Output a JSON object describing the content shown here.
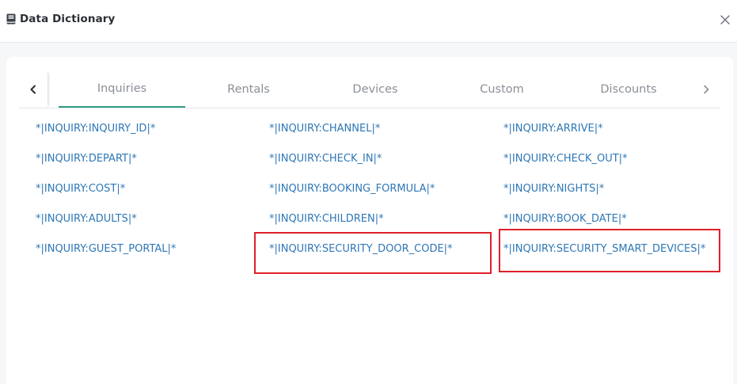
{
  "dialog": {
    "title": "Data Dictionary",
    "icons": {
      "title": "book-icon",
      "close": "close-icon"
    }
  },
  "tabs": {
    "prev_icon": "chevron-left-icon",
    "next_icon": "chevron-right-icon",
    "items": [
      {
        "label": "Inquiries",
        "active": true
      },
      {
        "label": "Rentals",
        "active": false
      },
      {
        "label": "Devices",
        "active": false
      },
      {
        "label": "Custom",
        "active": false
      },
      {
        "label": "Discounts",
        "active": false
      }
    ]
  },
  "variables": {
    "col1": [
      "*|INQUIRY:INQUIRY_ID|*",
      "*|INQUIRY:DEPART|*",
      "*|INQUIRY:COST|*",
      "*|INQUIRY:ADULTS|*",
      "*|INQUIRY:GUEST_PORTAL|*"
    ],
    "col2": [
      "*|INQUIRY:CHANNEL|*",
      "*|INQUIRY:CHECK_IN|*",
      "*|INQUIRY:BOOKING_FORMULA|*",
      "*|INQUIRY:CHILDREN|*",
      "*|INQUIRY:SECURITY_DOOR_CODE|*"
    ],
    "col3": [
      "*|INQUIRY:ARRIVE|*",
      "*|INQUIRY:CHECK_OUT|*",
      "*|INQUIRY:NIGHTS|*",
      "*|INQUIRY:BOOK_DATE|*",
      "*|INQUIRY:SECURITY_SMART_DEVICES|*"
    ]
  },
  "colors": {
    "link": "#2e77b6",
    "tab_active_underline": "#2f9e86",
    "highlight": "#e0202a"
  }
}
